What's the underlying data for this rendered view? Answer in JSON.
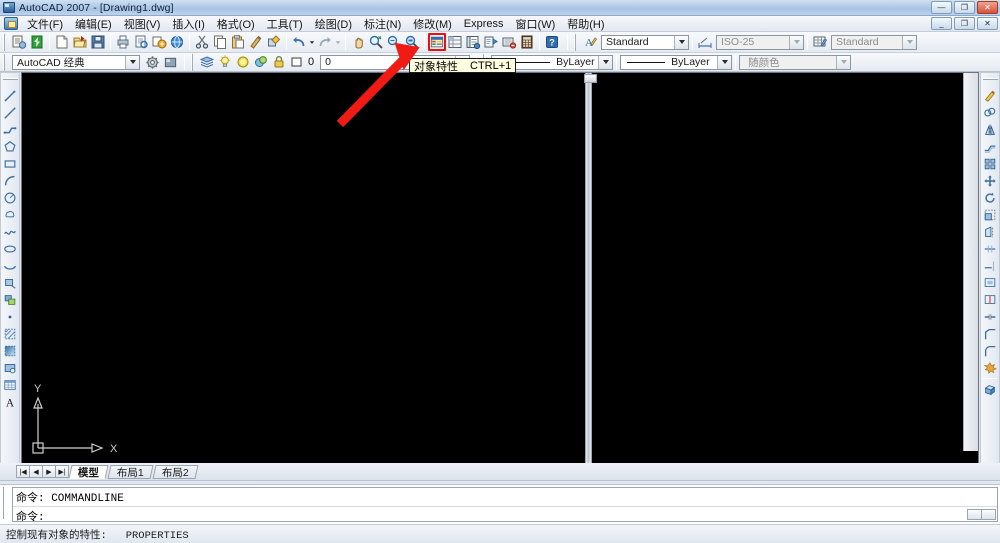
{
  "window": {
    "title": "AutoCAD 2007 - [Drawing1.dwg]",
    "app_icon": "autocad-icon",
    "buttons": {
      "minimize": "—",
      "maximize": "❐",
      "close": "✕"
    },
    "mdi_buttons": {
      "minimize": "_",
      "restore": "❐",
      "close": "✕"
    }
  },
  "menubar": {
    "items": [
      {
        "label": "文件(F)",
        "name": "menu-file"
      },
      {
        "label": "编辑(E)",
        "name": "menu-edit"
      },
      {
        "label": "视图(V)",
        "name": "menu-view"
      },
      {
        "label": "插入(I)",
        "name": "menu-insert"
      },
      {
        "label": "格式(O)",
        "name": "menu-format"
      },
      {
        "label": "工具(T)",
        "name": "menu-tools"
      },
      {
        "label": "绘图(D)",
        "name": "menu-draw"
      },
      {
        "label": "标注(N)",
        "name": "menu-dimension"
      },
      {
        "label": "修改(M)",
        "name": "menu-modify"
      },
      {
        "label": "Express",
        "name": "menu-express"
      },
      {
        "label": "窗口(W)",
        "name": "menu-window"
      },
      {
        "label": "帮助(H)",
        "name": "menu-help"
      }
    ]
  },
  "toolbar_standard": {
    "buttons": [
      {
        "name": "qnew-icon",
        "title": "QNew"
      },
      {
        "name": "express-tools-icon",
        "title": "Express Tools"
      },
      {
        "name": "new-icon",
        "title": "新建"
      },
      {
        "name": "open-icon",
        "title": "打开"
      },
      {
        "name": "save-icon",
        "title": "保存"
      },
      {
        "name": "plot-icon",
        "title": "打印"
      },
      {
        "name": "plot-preview-icon",
        "title": "打印预览"
      },
      {
        "name": "publish-icon",
        "title": "发布"
      },
      {
        "name": "3dwalk-icon",
        "title": "三维漫游"
      },
      {
        "name": "cut-icon",
        "title": "剪切"
      },
      {
        "name": "copy-icon",
        "title": "复制"
      },
      {
        "name": "paste-icon",
        "title": "粘贴"
      },
      {
        "name": "matchprop-icon",
        "title": "特性匹配"
      },
      {
        "name": "block-editor-icon",
        "title": "块编辑器"
      },
      {
        "name": "undo-icon",
        "title": "放弃"
      },
      {
        "name": "undo-dropdown-icon",
        "title": "放弃列表"
      },
      {
        "name": "redo-icon",
        "title": "重做"
      },
      {
        "name": "redo-dropdown-icon",
        "title": "重做列表"
      },
      {
        "name": "pan-icon",
        "title": "实时平移"
      },
      {
        "name": "zoom-realtime-icon",
        "title": "实时缩放"
      },
      {
        "name": "zoom-window-icon",
        "title": "窗口缩放"
      },
      {
        "name": "zoom-previous-icon",
        "title": "缩放上一个"
      },
      {
        "name": "properties-icon",
        "title": "对象特性"
      },
      {
        "name": "designcenter-icon",
        "title": "设计中心"
      },
      {
        "name": "tool-palettes-icon",
        "title": "工具选项板"
      },
      {
        "name": "sheet-set-icon",
        "title": "图纸集管理器"
      },
      {
        "name": "markup-set-icon",
        "title": "标记集管理器"
      },
      {
        "name": "quickcalc-icon",
        "title": "快速计算器"
      },
      {
        "name": "help-icon",
        "title": "帮助"
      }
    ],
    "highlighted_button": "properties-icon",
    "styles": {
      "text_style": {
        "label": "Standard",
        "icon": "text-style-icon"
      },
      "dim_style": {
        "label": "ISO-25",
        "icon": "dim-style-icon"
      },
      "table_style": {
        "label": "Standard",
        "icon": "table-style-icon"
      }
    }
  },
  "tooltip": {
    "visible": true,
    "label": "对象特性",
    "shortcut": "CTRL+1"
  },
  "toolbar_workspace": {
    "workspace": {
      "value": "AutoCAD 经典",
      "name": "workspace-dropdown"
    },
    "buttons": [
      {
        "name": "workspace-settings-icon",
        "title": "工作空间设置"
      },
      {
        "name": "my-workspace-icon",
        "title": "我的工作空间"
      }
    ]
  },
  "toolbar_layers": {
    "layer_manager_icon": "layer-properties-manager-icon",
    "layer_value": "0",
    "state_icons": [
      {
        "name": "layer-on-icon",
        "title": "开/关"
      },
      {
        "name": "layer-freeze-icon",
        "title": "冻结"
      },
      {
        "name": "layer-freeze-vp-icon",
        "title": "在视口中冻结"
      },
      {
        "name": "layer-lock-icon",
        "title": "锁定"
      },
      {
        "name": "layer-color-icon",
        "title": "颜色"
      }
    ]
  },
  "toolbar_properties": {
    "color": {
      "value": "ByLayer",
      "name": "color-dropdown",
      "swatch_line": true
    },
    "linetype": {
      "value": "ByLayer",
      "name": "linetype-dropdown",
      "swatch_line": true
    },
    "lineweight": {
      "value": "随颜色",
      "name": "lineweight-dropdown",
      "disabled": true
    }
  },
  "toolbar_draw": {
    "name": "draw-toolbar",
    "buttons": [
      {
        "name": "line-icon",
        "title": "直线"
      },
      {
        "name": "construction-line-icon",
        "title": "构造线"
      },
      {
        "name": "polyline-icon",
        "title": "多段线"
      },
      {
        "name": "polygon-icon",
        "title": "正多边形"
      },
      {
        "name": "rectangle-icon",
        "title": "矩形"
      },
      {
        "name": "arc-icon",
        "title": "圆弧"
      },
      {
        "name": "circle-icon",
        "title": "圆"
      },
      {
        "name": "revision-cloud-icon",
        "title": "修订云线"
      },
      {
        "name": "spline-icon",
        "title": "样条曲线"
      },
      {
        "name": "ellipse-icon",
        "title": "椭圆"
      },
      {
        "name": "ellipse-arc-icon",
        "title": "椭圆弧"
      },
      {
        "name": "insert-block-icon",
        "title": "插入块"
      },
      {
        "name": "make-block-icon",
        "title": "创建块"
      },
      {
        "name": "point-icon",
        "title": "点"
      },
      {
        "name": "hatch-icon",
        "title": "图案填充"
      },
      {
        "name": "gradient-icon",
        "title": "渐变色"
      },
      {
        "name": "region-icon",
        "title": "面域"
      },
      {
        "name": "table-icon",
        "title": "表格"
      },
      {
        "name": "mtext-icon",
        "title": "多行文字"
      }
    ]
  },
  "toolbar_modify": {
    "name": "modify-toolbar",
    "buttons": [
      {
        "name": "erase-icon",
        "title": "删除"
      },
      {
        "name": "copy-object-icon",
        "title": "复制"
      },
      {
        "name": "mirror-icon",
        "title": "镜像"
      },
      {
        "name": "offset-icon",
        "title": "偏移"
      },
      {
        "name": "array-icon",
        "title": "阵列"
      },
      {
        "name": "move-icon",
        "title": "移动"
      },
      {
        "name": "rotate-icon",
        "title": "旋转"
      },
      {
        "name": "scale-icon",
        "title": "缩放"
      },
      {
        "name": "stretch-icon",
        "title": "拉伸"
      },
      {
        "name": "trim-icon",
        "title": "修剪"
      },
      {
        "name": "extend-icon",
        "title": "延伸"
      },
      {
        "name": "break-at-point-icon",
        "title": "打断于点"
      },
      {
        "name": "break-icon",
        "title": "打断"
      },
      {
        "name": "join-icon",
        "title": "合并"
      },
      {
        "name": "chamfer-icon",
        "title": "倒角"
      },
      {
        "name": "fillet-icon",
        "title": "圆角"
      },
      {
        "name": "explode-icon",
        "title": "分解"
      },
      {
        "name": "match-3d-icon",
        "title": "三维操作"
      }
    ]
  },
  "canvas": {
    "background": "#000000",
    "ucs": {
      "x_label": "X",
      "y_label": "Y",
      "name": "ucs-icon"
    }
  },
  "layout_tabs": {
    "nav": [
      {
        "name": "tab-nav-first",
        "glyph": "|◀"
      },
      {
        "name": "tab-nav-prev",
        "glyph": "◀"
      },
      {
        "name": "tab-nav-next",
        "glyph": "▶"
      },
      {
        "name": "tab-nav-last",
        "glyph": "▶|"
      }
    ],
    "tabs": [
      {
        "label": "模型",
        "name": "tab-model",
        "active": true
      },
      {
        "label": "布局1",
        "name": "tab-layout1",
        "active": false
      },
      {
        "label": "布局2",
        "name": "tab-layout2",
        "active": false
      }
    ]
  },
  "command_line": {
    "line1": "命令: COMMANDLINE",
    "line2": "命令:"
  },
  "status_bar": {
    "text": "控制现有对象的特性:   PROPERTIES"
  },
  "annotation": {
    "arrow_color": "#ef1b14",
    "highlight_color": "#e8110f"
  }
}
